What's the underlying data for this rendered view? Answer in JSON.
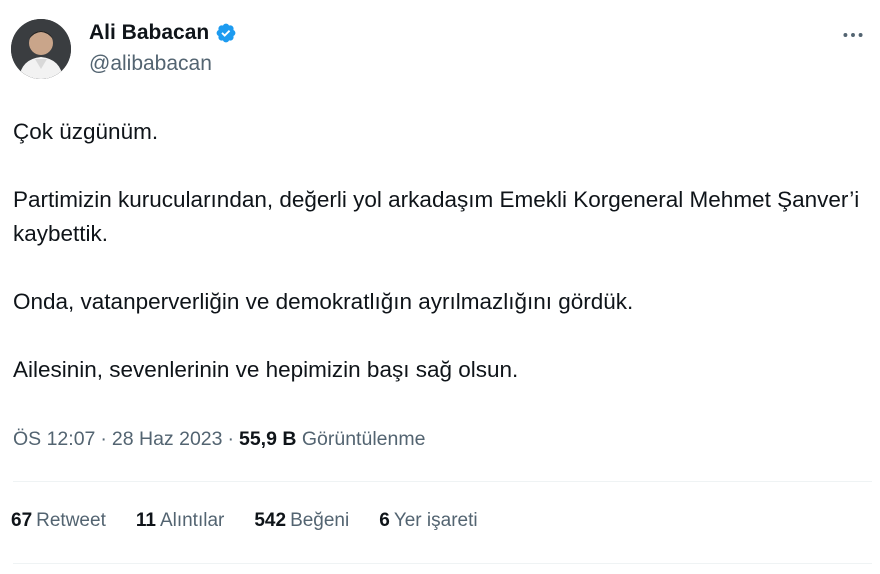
{
  "author": {
    "display_name": "Ali Babacan",
    "handle": "@alibabacan",
    "verified": true,
    "verified_color": "#1d9bf0"
  },
  "tweet": {
    "paragraphs": [
      "Çok üzgünüm.",
      "Partimizin kurucularından, değerli yol arkadaşım Emekli Korgeneral Mehmet Şanver’i kaybettik.",
      "Onda, vatanperverliğin ve demokratlığın ayrılmazlığını gördük.",
      "Ailesinin, sevenlerinin ve hepimizin başı sağ olsun."
    ]
  },
  "meta": {
    "time": "ÖS 12:07",
    "date": "28 Haz 2023",
    "separator": "·",
    "views_count": "55,9 B",
    "views_label": "Görüntülenme"
  },
  "stats": {
    "retweets": {
      "count": "67",
      "label": "Retweet"
    },
    "quotes": {
      "count": "11",
      "label": "Alıntılar"
    },
    "likes": {
      "count": "542",
      "label": "Beğeni"
    },
    "bookmarks": {
      "count": "6",
      "label": "Yer işareti"
    }
  },
  "icons": {
    "more": "more-horizontal-icon",
    "verified": "verified-badge-icon"
  }
}
